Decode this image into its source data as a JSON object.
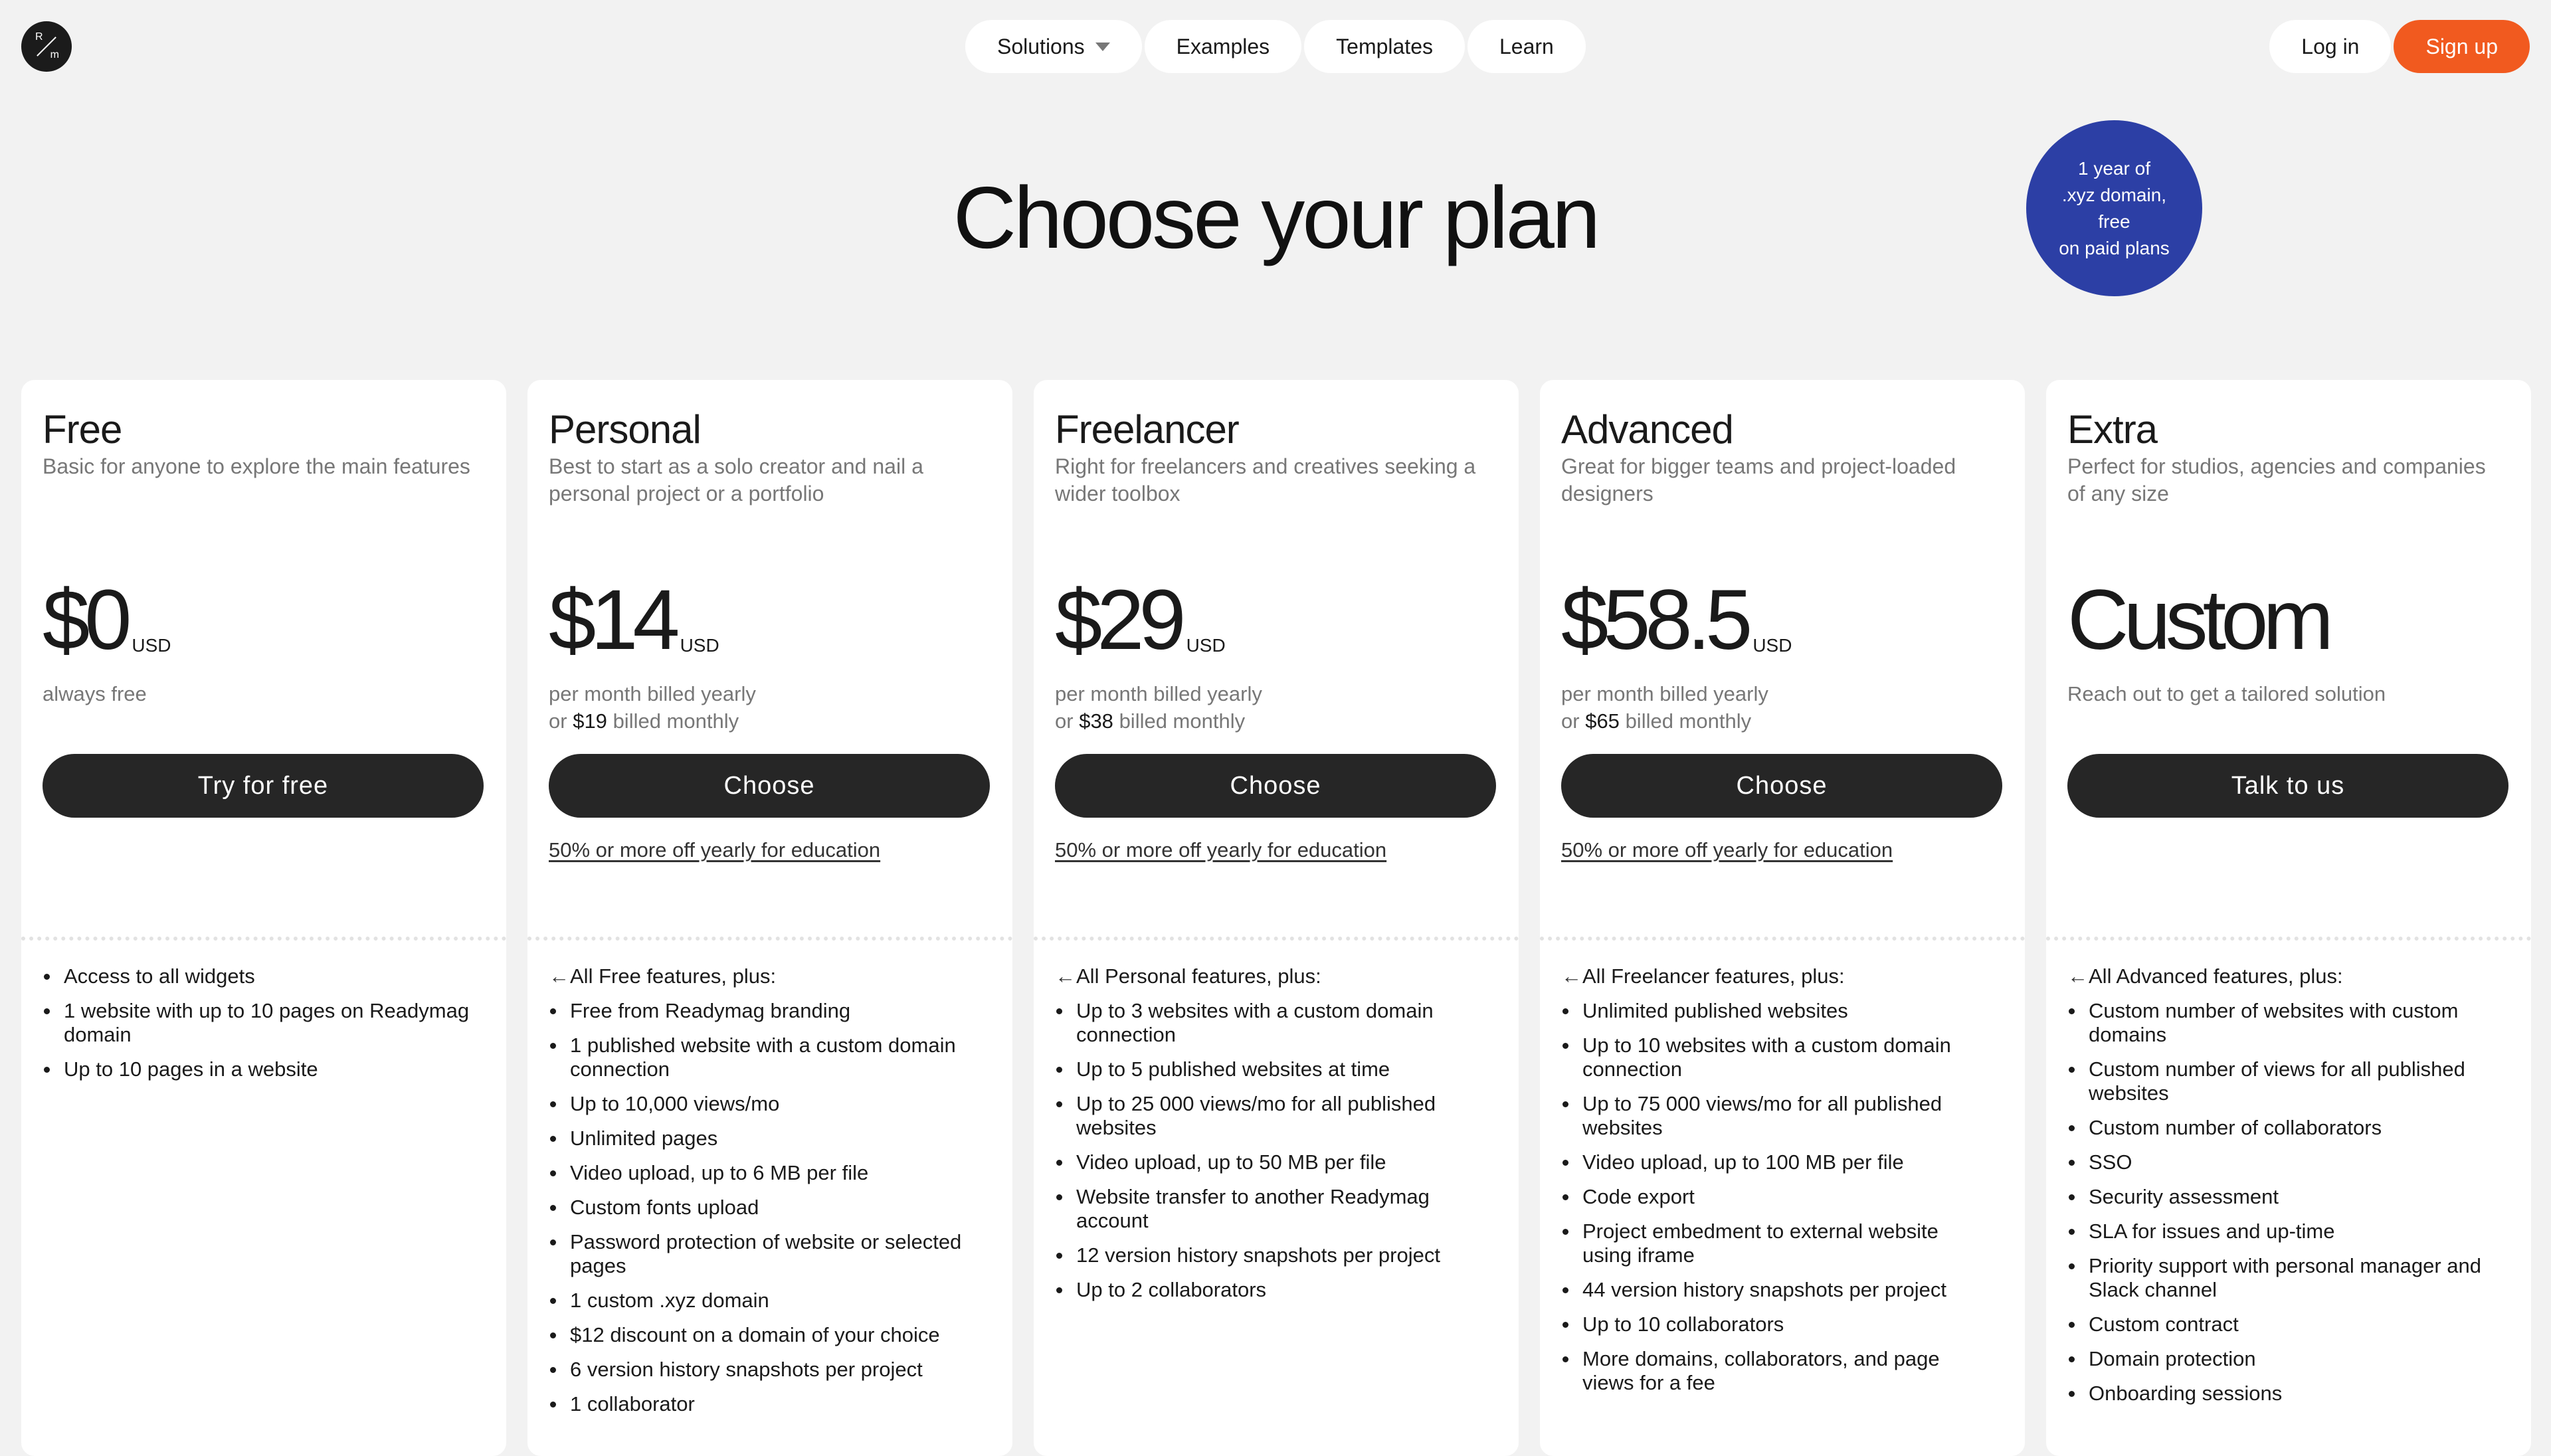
{
  "header": {
    "logo": {
      "top": "R",
      "bottom": "m"
    },
    "nav": [
      {
        "label": "Solutions",
        "has_dropdown": true
      },
      {
        "label": "Examples"
      },
      {
        "label": "Templates"
      },
      {
        "label": "Learn"
      }
    ],
    "login_label": "Log in",
    "signup_label": "Sign up"
  },
  "page_title": "Choose your plan",
  "badge": "1 year of\n.xyz domain,\nfree\non paid plans",
  "colors": {
    "accent": "#f15a1f",
    "badge": "#2c3fa5",
    "button": "#262626",
    "background": "#f2f2f2"
  },
  "plans": [
    {
      "name": "Free",
      "description": "Basic for anyone to explore the main features",
      "price": "$0",
      "currency": "USD",
      "billing_line1": "always free",
      "cta": "Try for free",
      "features": [
        "Access to all widgets",
        "1 website with up to 10 pages on Readymag domain",
        "Up to 10 pages in a website"
      ]
    },
    {
      "name": "Personal",
      "description": "Best to start as a solo creator and nail a personal project or a portfolio",
      "price": "$14",
      "currency": "USD",
      "billing_line1": "per month billed yearly",
      "billing_or": "or",
      "billing_monthly_price": "$19",
      "billing_monthly_suffix": "billed monthly",
      "cta": "Choose",
      "education": "50% or more off yearly for education",
      "lead": "All Free features, plus:",
      "features": [
        "Free from Readymag branding",
        "1 published website with a custom domain connection",
        "Up to 10,000 views/mo",
        "Unlimited pages",
        "Video upload, up to 6 MB per file",
        "Custom fonts upload",
        "Password protection of website or selected pages",
        "1 custom .xyz domain",
        "$12 discount on a domain of your choice",
        "6 version history snapshots per project",
        "1 collaborator"
      ]
    },
    {
      "name": "Freelancer",
      "description": "Right for freelancers and creatives seeking a wider toolbox",
      "price": "$29",
      "currency": "USD",
      "billing_line1": "per month billed yearly",
      "billing_or": "or",
      "billing_monthly_price": "$38",
      "billing_monthly_suffix": "billed monthly",
      "cta": "Choose",
      "education": "50% or more off yearly for education",
      "lead": "All Personal features, plus:",
      "features": [
        "Up to 3 websites with a custom domain connection",
        "Up to 5 published websites at time",
        "Up to 25 000 views/mo for all published websites",
        "Video upload, up to 50 MB per file",
        "Website transfer to another Readymag account",
        "12 version history snapshots per project",
        "Up to 2 collaborators"
      ]
    },
    {
      "name": "Advanced",
      "description": "Great for bigger teams and project-loaded designers",
      "price": "$58.5",
      "currency": "USD",
      "billing_line1": "per month billed yearly",
      "billing_or": "or",
      "billing_monthly_price": "$65",
      "billing_monthly_suffix": "billed monthly",
      "cta": "Choose",
      "education": "50% or more off yearly for education",
      "lead": "All Freelancer features, plus:",
      "features": [
        "Unlimited published websites",
        "Up to 10 websites with a custom domain connection",
        "Up to 75 000 views/mo for all published websites",
        "Video upload, up to 100 MB per file",
        "Code export",
        "Project embedment to external website using iframe",
        "44 version history snapshots per project",
        "Up to 10 collaborators",
        "More domains, collaborators, and page views for a fee"
      ]
    },
    {
      "name": "Extra",
      "description": "Perfect for studios, agencies and companies of any size",
      "price": "Custom",
      "billing_line1": "Reach out to get a tailored solution",
      "cta": "Talk to us",
      "lead": "All Advanced features, plus:",
      "features": [
        "Custom number of websites with custom domains",
        "Custom number of views for all published websites",
        "Custom number of collaborators",
        "SSO",
        "Security assessment",
        "SLA for issues and up-time",
        "Priority support with personal manager and Slack channel",
        "Custom contract",
        "Domain protection",
        "Onboarding sessions"
      ]
    }
  ]
}
